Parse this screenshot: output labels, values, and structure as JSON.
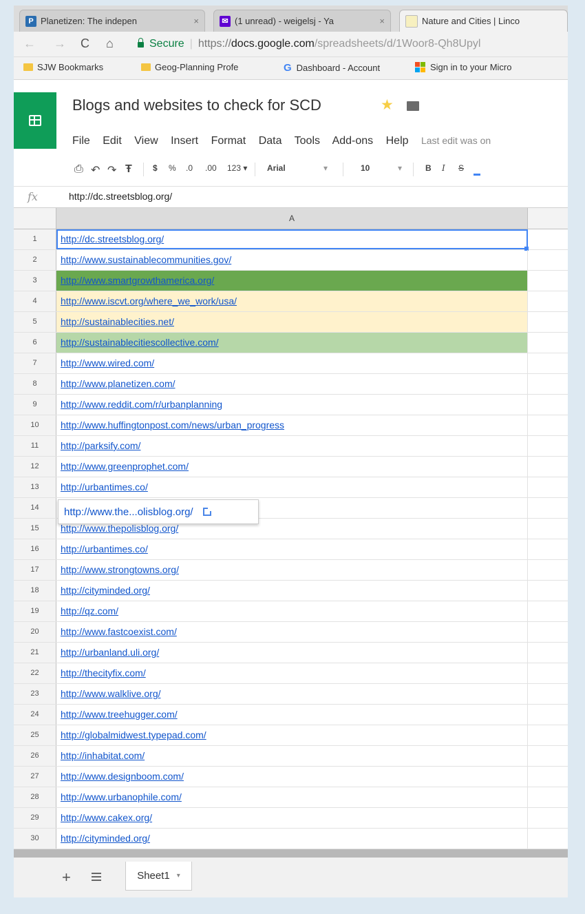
{
  "browser": {
    "tabs": [
      {
        "title": "Planetizen: The indepen",
        "favicon": "P",
        "favicon_color": "#2a6db0"
      },
      {
        "title": "(1 unread) - weigelsj - Ya",
        "favicon": "✉",
        "favicon_color": "#6001d2"
      },
      {
        "title": "Nature and Cities | Linco",
        "favicon": "",
        "favicon_color": "#f7f0c0"
      }
    ],
    "close_glyph": "×",
    "nav": {
      "back": "←",
      "forward": "→",
      "reload": "C",
      "home": "⌂"
    },
    "address": {
      "secure_label": "Secure",
      "url_scheme": "https://",
      "url_domain": "docs.google.com",
      "url_path": "/spreadsheets/d/1Woor8-Qh8Upyl"
    },
    "bookmarks": [
      {
        "label": "SJW Bookmarks",
        "icon": "folder-icon"
      },
      {
        "label": "Geog-Planning Profe",
        "icon": "folder-icon"
      },
      {
        "label": "Dashboard - Account",
        "icon": "google-icon"
      },
      {
        "label": "Sign in to your Micro",
        "icon": "microsoft-icon"
      }
    ]
  },
  "sheets": {
    "doc_title": "Blogs and websites to check for SCD",
    "menu": [
      "File",
      "Edit",
      "View",
      "Insert",
      "Format",
      "Data",
      "Tools",
      "Add-ons",
      "Help"
    ],
    "last_edit": "Last edit was on",
    "toolbar": {
      "print": "⎙",
      "undo": "↶",
      "redo": "↷",
      "paint": "Ŧ",
      "currency": "$",
      "percent": "%",
      "dec_minus": ".0",
      "dec_plus": ".00",
      "format_more": "123 ▾",
      "font": "Arial",
      "size": "10",
      "bold": "B",
      "italic": "I",
      "strike": "S",
      "dropdown": "▾"
    },
    "formula_label": "fx",
    "formula_value": "http://dc.streetsblog.org/",
    "column_a": "A",
    "rows": [
      {
        "n": "1",
        "url": "http://dc.streetsblog.org/",
        "fill": "selected"
      },
      {
        "n": "2",
        "url": "http://www.sustainablecommunities.gov/",
        "fill": ""
      },
      {
        "n": "3",
        "url": "http://www.smartgrowthamerica.org/",
        "fill": "green-dark"
      },
      {
        "n": "4",
        "url": "http://www.iscvt.org/where_we_work/usa/",
        "fill": "yellow"
      },
      {
        "n": "5",
        "url": "http://sustainablecities.net/",
        "fill": "yellow"
      },
      {
        "n": "6",
        "url": "http://sustainablecitiescollective.com/",
        "fill": "green-light"
      },
      {
        "n": "7",
        "url": "http://www.wired.com/",
        "fill": ""
      },
      {
        "n": "8",
        "url": "http://www.planetizen.com/",
        "fill": ""
      },
      {
        "n": "9",
        "url": "http://www.reddit.com/r/urbanplanning",
        "fill": ""
      },
      {
        "n": "10",
        "url": "http://www.huffingtonpost.com/news/urban_progress",
        "fill": ""
      },
      {
        "n": "11",
        "url": "http://parksify.com/",
        "fill": ""
      },
      {
        "n": "12",
        "url": "http://www.greenprophet.com/",
        "fill": ""
      },
      {
        "n": "13",
        "url": "http://urbantimes.co/",
        "fill": ""
      },
      {
        "n": "14",
        "url": "",
        "fill": ""
      },
      {
        "n": "15",
        "url": "http://www.thepolisblog.org/",
        "fill": ""
      },
      {
        "n": "16",
        "url": "http://urbantimes.co/",
        "fill": ""
      },
      {
        "n": "17",
        "url": "http://www.strongtowns.org/",
        "fill": ""
      },
      {
        "n": "18",
        "url": "http://cityminded.org/",
        "fill": ""
      },
      {
        "n": "19",
        "url": "http://qz.com/",
        "fill": ""
      },
      {
        "n": "20",
        "url": "http://www.fastcoexist.com/",
        "fill": ""
      },
      {
        "n": "21",
        "url": "http://urbanland.uli.org/",
        "fill": ""
      },
      {
        "n": "22",
        "url": "http://thecityfix.com/",
        "fill": ""
      },
      {
        "n": "23",
        "url": "http://www.walklive.org/",
        "fill": ""
      },
      {
        "n": "24",
        "url": "http://www.treehugger.com/",
        "fill": ""
      },
      {
        "n": "25",
        "url": "http://globalmidwest.typepad.com/",
        "fill": ""
      },
      {
        "n": "26",
        "url": "http://inhabitat.com/",
        "fill": ""
      },
      {
        "n": "27",
        "url": "http://www.designboom.com/",
        "fill": ""
      },
      {
        "n": "28",
        "url": "http://www.urbanophile.com/",
        "fill": ""
      },
      {
        "n": "29",
        "url": "http://www.cakex.org/",
        "fill": ""
      },
      {
        "n": "30",
        "url": "http://cityminded.org/",
        "fill": ""
      }
    ],
    "link_tooltip": "http://www.the...olisblog.org/",
    "sheet_tab": "Sheet1",
    "add_sheet": "+",
    "tab_caret": "▾"
  }
}
